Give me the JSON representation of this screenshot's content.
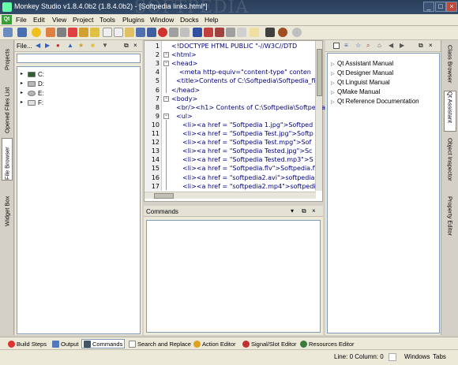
{
  "window": {
    "title": "Monkey Studio v1.8.4.0b2 (1.8.4.0b2) - [Softpedia links.html*]",
    "watermark": "SOFTPEDIA"
  },
  "menu": [
    "File",
    "Edit",
    "View",
    "Project",
    "Tools",
    "Plugins",
    "Window",
    "Docks",
    "Help"
  ],
  "left_dock": {
    "header": "File...",
    "drives": [
      {
        "label": "C:",
        "expanded": false
      },
      {
        "label": "D:",
        "expanded": false
      },
      {
        "label": "E:",
        "expanded": false
      },
      {
        "label": "F:",
        "expanded": false
      }
    ]
  },
  "left_tabs": [
    "Projects",
    "Opened Files List",
    "File Browser",
    "Widget Box"
  ],
  "editor": {
    "lines": [
      {
        "n": "1",
        "code": "<!DOCTYPE HTML PUBLIC \"-//W3C//DTD"
      },
      {
        "n": "2",
        "code": "<html>"
      },
      {
        "n": "3",
        "code": "<head>"
      },
      {
        "n": "4",
        "code": "<meta http-equiv=\"content-type\" conten"
      },
      {
        "n": "5",
        "code": "<title>Contents of C:\\Softpedia\\Softpedia_file"
      },
      {
        "n": "6",
        "code": "</head>"
      },
      {
        "n": "7",
        "code": "<body>"
      },
      {
        "n": "8",
        "code": "<br/><h1> Contents of C:\\Softpedia\\Softpedia"
      },
      {
        "n": "9",
        "code": "<ul>"
      },
      {
        "n": "10",
        "code": "<li><a href = \"Softpedia 1.jpg\">Softped"
      },
      {
        "n": "11",
        "code": "<li><a href = \"Softpedia Test.jpg\">Softp"
      },
      {
        "n": "12",
        "code": "<li><a href = \"Softpedia Test.mpg\">Sof"
      },
      {
        "n": "13",
        "code": "<li><a href = \"Softpedia Tested.jpg\">Sc"
      },
      {
        "n": "14",
        "code": "<li><a href = \"Softpedia Tested.mp3\">S"
      },
      {
        "n": "15",
        "code": "<li><a href = \"Softpedia.flv\">Softpedia.fl"
      },
      {
        "n": "16",
        "code": "<li><a href = \"softpedia2.avi\">softpedia2."
      },
      {
        "n": "17",
        "code": "<li><a href = \"softpedia2.mp4\">softpedia"
      }
    ]
  },
  "commands_dock": {
    "title": "Commands"
  },
  "assistant": {
    "items": [
      "Qt Assistant Manual",
      "Qt Designer Manual",
      "Qt Linguist Manual",
      "QMake Manual",
      "Qt Reference Documentation"
    ]
  },
  "right_tabs": [
    "Class Browser",
    "Qt Assistant",
    "Object Inspector",
    "Property Editor"
  ],
  "bottom_tabs": [
    {
      "label": "Build Steps",
      "color": "#d33"
    },
    {
      "label": "Output",
      "color": "#5577bb"
    },
    {
      "label": "Commands",
      "color": "#445566"
    },
    {
      "label": "Search and Replace",
      "color": "#999"
    },
    {
      "label": "Action Editor",
      "color": "#e0a020"
    },
    {
      "label": "Signal/Slot Editor",
      "color": "#c03030"
    },
    {
      "label": "Resources Editor",
      "color": "#3a7a3a"
    }
  ],
  "status": {
    "position": "Line: 0 Column: 0",
    "windows": "Windows",
    "tabs": "Tabs"
  }
}
